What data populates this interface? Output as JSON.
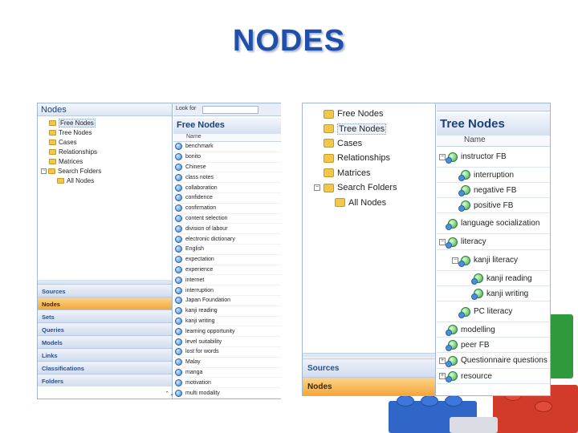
{
  "slide_title": "NODES",
  "left": {
    "nav_header": "Nodes",
    "tree": [
      {
        "label": "Free Nodes",
        "expander": "",
        "indent": 1,
        "selected": true
      },
      {
        "label": "Tree Nodes",
        "expander": "",
        "indent": 1,
        "selected": false
      },
      {
        "label": "Cases",
        "expander": "",
        "indent": 1,
        "selected": false
      },
      {
        "label": "Relationships",
        "expander": "",
        "indent": 1,
        "selected": false
      },
      {
        "label": "Matrices",
        "expander": "",
        "indent": 1,
        "selected": false
      },
      {
        "label": "Search Folders",
        "expander": "−",
        "indent": 0,
        "selected": false
      },
      {
        "label": "All Nodes",
        "expander": "",
        "indent": 2,
        "selected": false
      }
    ],
    "nav_buttons": [
      "Sources",
      "Nodes",
      "Sets",
      "Queries",
      "Models",
      "Links",
      "Classifications",
      "Folders"
    ],
    "active_nav": "Nodes",
    "look_for_label": "Look for",
    "list_title": "Free Nodes",
    "column_header": "Name",
    "list_items": [
      "benchmark",
      "bonito",
      "Chinese",
      "class notes",
      "collaboration",
      "confidence",
      "confirmation",
      "content selection",
      "division of labour",
      "electronic dictionary",
      "English",
      "expectation",
      "experience",
      "internet",
      "interruption",
      "Japan Foundation",
      "kanji reading",
      "kanji writing",
      "learning opportunity",
      "level suitability",
      "lost for words",
      "Malay",
      "manga",
      "motivation",
      "multi modality"
    ],
    "scroll_arrows": "⌃⌄"
  },
  "right": {
    "tree": [
      {
        "label": "Free Nodes",
        "expander": "",
        "indent": 1,
        "selected": false
      },
      {
        "label": "Tree Nodes",
        "expander": "",
        "indent": 1,
        "selected": true
      },
      {
        "label": "Cases",
        "expander": "",
        "indent": 1,
        "selected": false
      },
      {
        "label": "Relationships",
        "expander": "",
        "indent": 1,
        "selected": false
      },
      {
        "label": "Matrices",
        "expander": "",
        "indent": 1,
        "selected": false
      },
      {
        "label": "Search Folders",
        "expander": "−",
        "indent": 0,
        "selected": false
      },
      {
        "label": "All Nodes",
        "expander": "",
        "indent": 2,
        "selected": false
      }
    ],
    "nav_buttons": [
      "Sources",
      "Nodes"
    ],
    "active_nav": "Nodes",
    "list_title": "Tree Nodes",
    "column_header": "Name",
    "list_items": [
      {
        "label": "instructor FB",
        "level": 0,
        "expander": "−"
      },
      {
        "label": "interruption",
        "level": 1,
        "expander": ""
      },
      {
        "label": "negative FB",
        "level": 1,
        "expander": ""
      },
      {
        "label": "positive FB",
        "level": 1,
        "expander": ""
      },
      {
        "label": "language socialization",
        "level": 0,
        "expander": ""
      },
      {
        "label": "literacy",
        "level": 0,
        "expander": "−"
      },
      {
        "label": "kanji literacy",
        "level": 1,
        "expander": "−"
      },
      {
        "label": "kanji reading",
        "level": 2,
        "expander": ""
      },
      {
        "label": "kanji writing",
        "level": 2,
        "expander": ""
      },
      {
        "label": "PC literacy",
        "level": 1,
        "expander": ""
      },
      {
        "label": "modelling",
        "level": 0,
        "expander": ""
      },
      {
        "label": "peer FB",
        "level": 0,
        "expander": ""
      },
      {
        "label": "Questionnaire questions",
        "level": 0,
        "expander": "+"
      },
      {
        "label": "resource",
        "level": 0,
        "expander": "+"
      }
    ]
  },
  "colors": {
    "title": "#1f4fa8",
    "panel_header_text": "#1e3f77",
    "active_nav_top": "#fcd48a",
    "active_nav_bottom": "#f5a63a",
    "nav_button_top": "#eef3fa",
    "nav_button_bottom": "#d2ddef",
    "folder": "#f1c84b",
    "lego_green": "#2f9a3c",
    "lego_blue": "#2f66c8",
    "lego_red": "#d23a2a"
  }
}
